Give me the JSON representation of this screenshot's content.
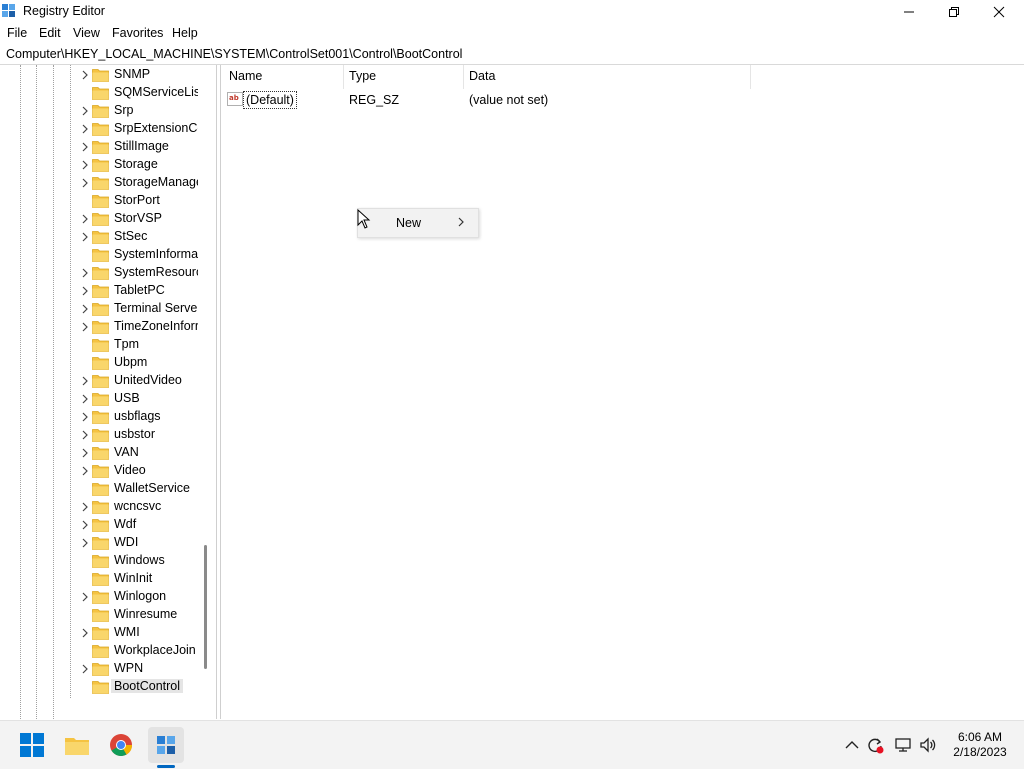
{
  "window": {
    "title": "Registry Editor"
  },
  "menu": [
    "File",
    "Edit",
    "View",
    "Favorites",
    "Help"
  ],
  "address": "Computer\\HKEY_LOCAL_MACHINE\\SYSTEM\\ControlSet001\\Control\\BootControl",
  "tree": {
    "items": [
      {
        "label": "SNMP",
        "expandable": true
      },
      {
        "label": "SQMServiceList",
        "expandable": false
      },
      {
        "label": "Srp",
        "expandable": true
      },
      {
        "label": "SrpExtensionCo",
        "expandable": true
      },
      {
        "label": "StillImage",
        "expandable": true
      },
      {
        "label": "Storage",
        "expandable": true
      },
      {
        "label": "StorageManage",
        "expandable": true
      },
      {
        "label": "StorPort",
        "expandable": false
      },
      {
        "label": "StorVSP",
        "expandable": true
      },
      {
        "label": "StSec",
        "expandable": true
      },
      {
        "label": "SystemInformat",
        "expandable": false
      },
      {
        "label": "SystemResource",
        "expandable": true
      },
      {
        "label": "TabletPC",
        "expandable": true
      },
      {
        "label": "Terminal Server",
        "expandable": true
      },
      {
        "label": "TimeZoneInforr",
        "expandable": true
      },
      {
        "label": "Tpm",
        "expandable": false
      },
      {
        "label": "Ubpm",
        "expandable": false
      },
      {
        "label": "UnitedVideo",
        "expandable": true
      },
      {
        "label": "USB",
        "expandable": true
      },
      {
        "label": "usbflags",
        "expandable": true
      },
      {
        "label": "usbstor",
        "expandable": true
      },
      {
        "label": "VAN",
        "expandable": true
      },
      {
        "label": "Video",
        "expandable": true
      },
      {
        "label": "WalletService",
        "expandable": false
      },
      {
        "label": "wcncsvc",
        "expandable": true
      },
      {
        "label": "Wdf",
        "expandable": true
      },
      {
        "label": "WDI",
        "expandable": true
      },
      {
        "label": "Windows",
        "expandable": false
      },
      {
        "label": "WinInit",
        "expandable": false
      },
      {
        "label": "Winlogon",
        "expandable": true
      },
      {
        "label": "Winresume",
        "expandable": false
      },
      {
        "label": "WMI",
        "expandable": true
      },
      {
        "label": "WorkplaceJoin",
        "expandable": false
      },
      {
        "label": "WPN",
        "expandable": true
      },
      {
        "label": "BootControl",
        "expandable": false,
        "selected": true
      }
    ]
  },
  "list": {
    "columns": [
      "Name",
      "Type",
      "Data"
    ],
    "rows": [
      {
        "name": "(Default)",
        "type": "REG_SZ",
        "data": "(value not set)"
      }
    ]
  },
  "context_menu": {
    "items": [
      {
        "label": "New",
        "submenu": true
      }
    ]
  },
  "taskbar": {
    "apps": [
      "start-icon",
      "file-explorer-icon",
      "chrome-icon",
      "registry-editor-icon"
    ],
    "tray": [
      "chevron-up-icon",
      "sync-icon",
      "network-icon",
      "volume-icon"
    ],
    "time": "6:06 AM",
    "date": "2/18/2023"
  },
  "colors": {
    "folder": "#f5c342",
    "accent": "#0067c0",
    "selection": "#e5e5e5"
  }
}
